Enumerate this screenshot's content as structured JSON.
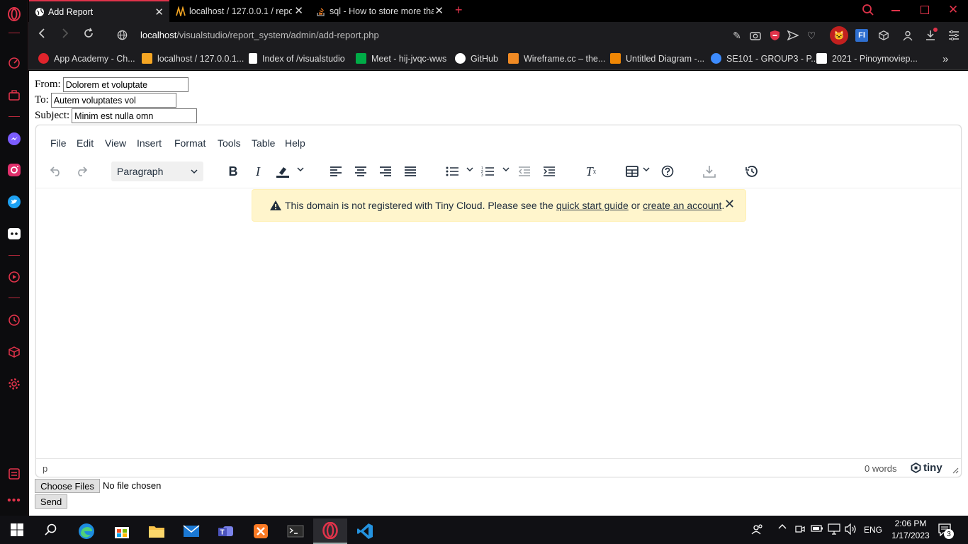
{
  "tabs": [
    {
      "title": "Add Report",
      "active": true
    },
    {
      "title": "localhost / 127.0.0.1 / report",
      "active": false
    },
    {
      "title": "sql - How to store more than",
      "active": false
    }
  ],
  "address": {
    "host": "localhost",
    "path": "/visualstudio/report_system/admin/add-report.php"
  },
  "bookmarks": [
    {
      "label": "App Academy - Ch...",
      "icon": "app-academy-icon",
      "color": "#e0242c"
    },
    {
      "label": "localhost / 127.0.0.1...",
      "icon": "phpmyadmin-icon",
      "color": "#f5a623"
    },
    {
      "label": "Index of /visualstudio",
      "icon": "document-icon",
      "color": "#ffffff"
    },
    {
      "label": "Meet - hij-jvqc-wws",
      "icon": "meet-icon",
      "color": "#00ac47"
    },
    {
      "label": "GitHub",
      "icon": "github-icon",
      "color": "#ffffff"
    },
    {
      "label": "Wireframe.cc – the...",
      "icon": "wireframe-icon",
      "color": "#f08a24"
    },
    {
      "label": "Untitled Diagram -...",
      "icon": "drawio-icon",
      "color": "#f08705"
    },
    {
      "label": "SE101 - GROUP3 - P...",
      "icon": "canva-icon",
      "color": "#3d8bfd"
    },
    {
      "label": "2021 - Pinoymoviep...",
      "icon": "pinoymovie-icon",
      "color": "#ffffff"
    }
  ],
  "form": {
    "from_label": "From:",
    "from_value": "Dolorem et voluptate",
    "to_label": "To:",
    "to_value": "Autem voluptates vol",
    "subject_label": "Subject:",
    "subject_value": "Minim est nulla omn",
    "choose_files": "Choose Files",
    "no_file": "No file chosen",
    "send": "Send"
  },
  "editor": {
    "menus": [
      "File",
      "Edit",
      "View",
      "Insert",
      "Format",
      "Tools",
      "Table",
      "Help"
    ],
    "block_format": "Paragraph",
    "notification_text": "This domain is not registered with Tiny Cloud. Please see the",
    "notification_link1": "quick start guide",
    "notification_or": "or",
    "notification_link2": "create an account",
    "notification_end": ".",
    "path": "p",
    "word_count": "0 words",
    "brand": "tiny"
  },
  "taskbar": {
    "time": "2:06 PM",
    "date": "1/17/2023",
    "lang": "ENG",
    "notifications": "3"
  },
  "colors": {
    "accent": "#e0334a",
    "notif_bg": "#fff5cc",
    "editor_text": "#222f3e"
  }
}
